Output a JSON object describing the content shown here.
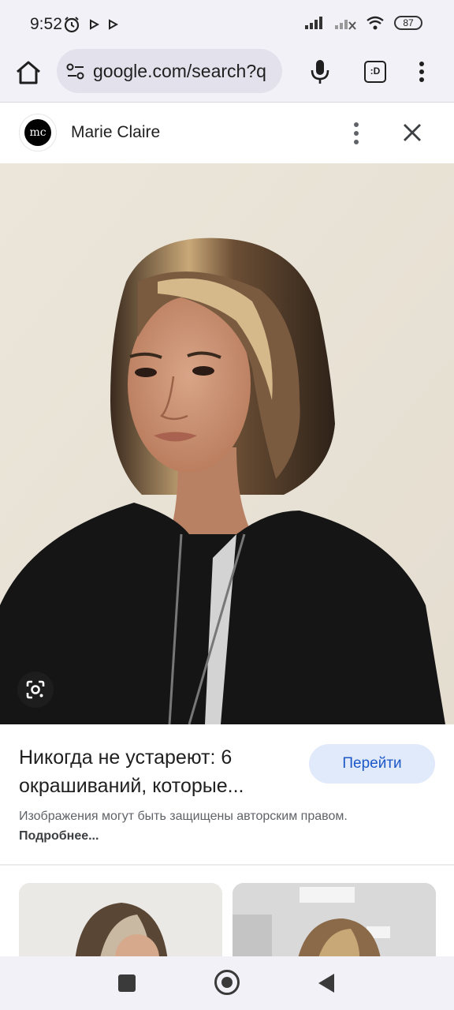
{
  "status_bar": {
    "time": "9:52",
    "battery": "87"
  },
  "browser": {
    "url": "google.com/search?q",
    "tabs_label": ":D"
  },
  "source": {
    "logo_text": "mc",
    "name": "Marie Claire"
  },
  "result": {
    "title": "Никогда не устареют: 6 окрашиваний, которые...",
    "visit_label": "Перейти",
    "copyright_text": "Изображения могут быть защищены авторским правом.",
    "learn_more": "Подробнее..."
  },
  "colors": {
    "accent": "#1b57c7",
    "accent_bg": "#e1eafb",
    "chrome_bg": "#f3f1f8"
  }
}
